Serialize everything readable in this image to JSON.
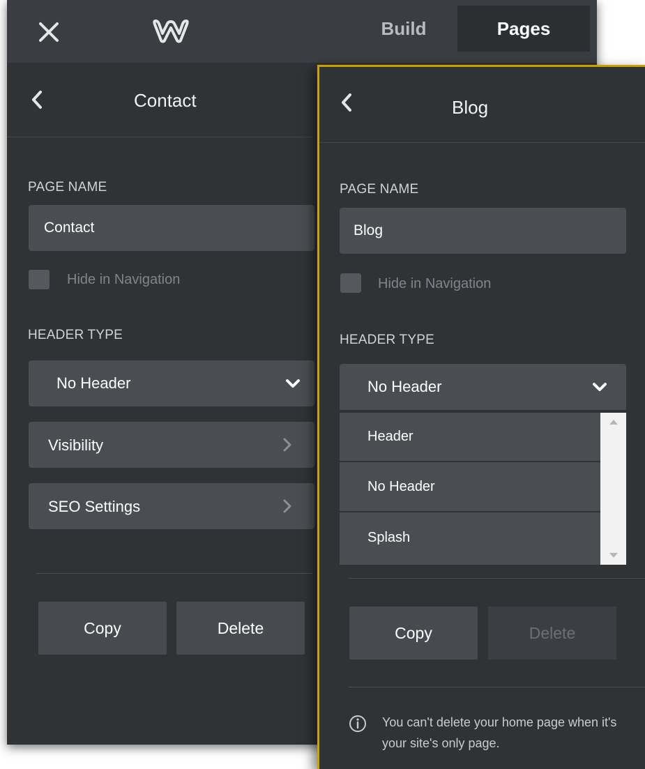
{
  "topbar": {
    "close_icon": "close-icon",
    "logo_icon": "weebly-logo-icon",
    "tabs": [
      {
        "label": "Build"
      },
      {
        "label": "Pages"
      }
    ]
  },
  "left_panel": {
    "title": "Contact",
    "page_name_label": "PAGE NAME",
    "page_name_value": "Contact",
    "hide_in_nav_label": "Hide in Navigation",
    "header_type_label": "HEADER TYPE",
    "header_type_value": "No Header",
    "visibility_label": "Visibility",
    "seo_label": "SEO Settings",
    "copy_label": "Copy",
    "delete_label": "Delete"
  },
  "right_panel": {
    "title": "Blog",
    "page_name_label": "PAGE NAME",
    "page_name_value": "Blog",
    "hide_in_nav_label": "Hide in Navigation",
    "header_type_label": "HEADER TYPE",
    "header_type_value": "No Header",
    "header_options": [
      "Header",
      "No Header",
      "Splash"
    ],
    "copy_label": "Copy",
    "delete_label": "Delete",
    "info_text": "You can't delete your home page when it's your site's only page."
  },
  "colors": {
    "panel_bg": "#2f3336",
    "control_bg": "#4a4e52",
    "highlight_border": "#c9a100"
  }
}
